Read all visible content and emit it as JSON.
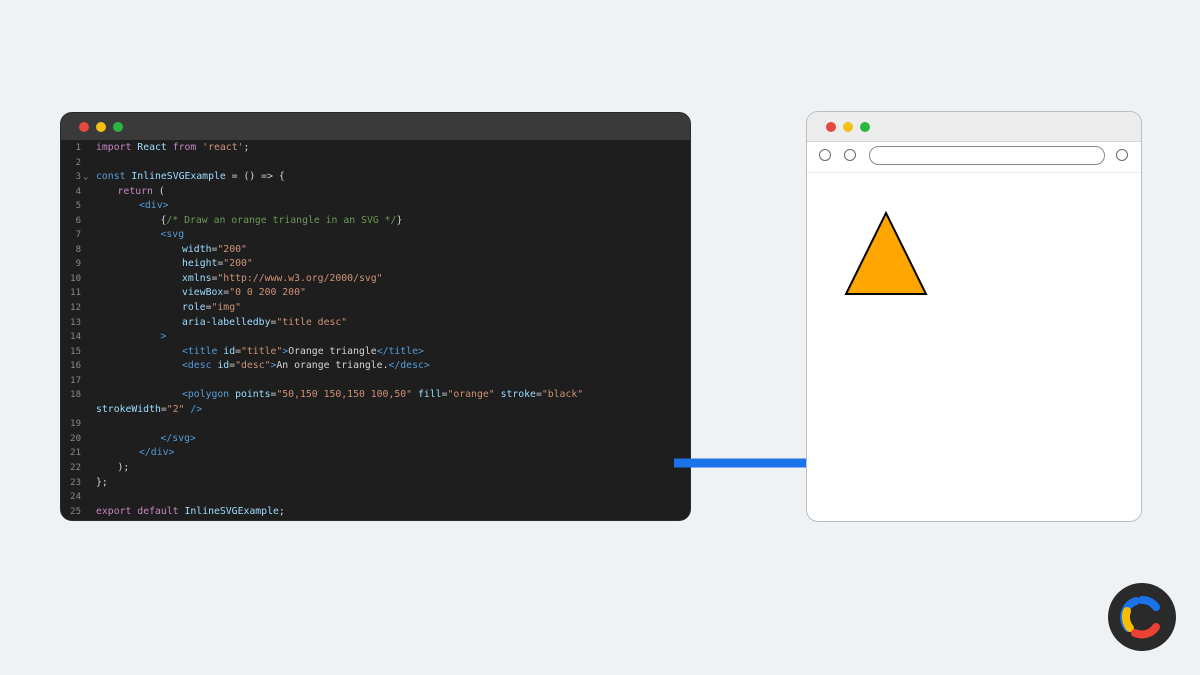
{
  "editor": {
    "lines": [
      {
        "n": "1",
        "fold": "",
        "indent": 0,
        "tokens": [
          [
            "kw",
            "import"
          ],
          [
            "pl",
            " "
          ],
          [
            "fn",
            "React"
          ],
          [
            "pl",
            " "
          ],
          [
            "kw",
            "from"
          ],
          [
            "pl",
            " "
          ],
          [
            "str",
            "'react'"
          ],
          [
            "pl",
            ";"
          ]
        ]
      },
      {
        "n": "2",
        "fold": "",
        "indent": 0,
        "tokens": []
      },
      {
        "n": "3",
        "fold": "⌄",
        "indent": 0,
        "tokens": [
          [
            "kw2",
            "const"
          ],
          [
            "pl",
            " "
          ],
          [
            "fn",
            "InlineSVGExample"
          ],
          [
            "pl",
            " = () => {"
          ]
        ]
      },
      {
        "n": "4",
        "fold": "",
        "indent": 1,
        "tokens": [
          [
            "kw",
            "return"
          ],
          [
            "pl",
            " ("
          ]
        ]
      },
      {
        "n": "5",
        "fold": "",
        "indent": 2,
        "tokens": [
          [
            "tag",
            "<div>"
          ]
        ]
      },
      {
        "n": "6",
        "fold": "",
        "indent": 3,
        "tokens": [
          [
            "pl",
            "{"
          ],
          [
            "cmt",
            "/* Draw an orange triangle in an SVG */"
          ],
          [
            "pl",
            "}"
          ]
        ]
      },
      {
        "n": "7",
        "fold": "",
        "indent": 3,
        "tokens": [
          [
            "tag",
            "<svg"
          ]
        ]
      },
      {
        "n": "8",
        "fold": "",
        "indent": 4,
        "tokens": [
          [
            "attr",
            "width"
          ],
          [
            "pl",
            "="
          ],
          [
            "str",
            "\"200\""
          ]
        ]
      },
      {
        "n": "9",
        "fold": "",
        "indent": 4,
        "tokens": [
          [
            "attr",
            "height"
          ],
          [
            "pl",
            "="
          ],
          [
            "str",
            "\"200\""
          ]
        ]
      },
      {
        "n": "10",
        "fold": "",
        "indent": 4,
        "tokens": [
          [
            "attr",
            "xmlns"
          ],
          [
            "pl",
            "="
          ],
          [
            "str",
            "\"http://www.w3.org/2000/svg\""
          ]
        ]
      },
      {
        "n": "11",
        "fold": "",
        "indent": 4,
        "tokens": [
          [
            "attr",
            "viewBox"
          ],
          [
            "pl",
            "="
          ],
          [
            "str",
            "\"0 0 200 200\""
          ]
        ]
      },
      {
        "n": "12",
        "fold": "",
        "indent": 4,
        "tokens": [
          [
            "attr",
            "role"
          ],
          [
            "pl",
            "="
          ],
          [
            "str",
            "\"img\""
          ]
        ]
      },
      {
        "n": "13",
        "fold": "",
        "indent": 4,
        "tokens": [
          [
            "attr",
            "aria-labelledby"
          ],
          [
            "pl",
            "="
          ],
          [
            "str",
            "\"title desc\""
          ]
        ]
      },
      {
        "n": "14",
        "fold": "",
        "indent": 3,
        "tokens": [
          [
            "tag",
            ">"
          ]
        ]
      },
      {
        "n": "15",
        "fold": "",
        "indent": 4,
        "tokens": [
          [
            "tag",
            "<title"
          ],
          [
            "pl",
            " "
          ],
          [
            "attr",
            "id"
          ],
          [
            "pl",
            "="
          ],
          [
            "str",
            "\"title\""
          ],
          [
            "tag",
            ">"
          ],
          [
            "pl",
            "Orange triangle"
          ],
          [
            "tag",
            "</title>"
          ]
        ]
      },
      {
        "n": "16",
        "fold": "",
        "indent": 4,
        "tokens": [
          [
            "tag",
            "<desc"
          ],
          [
            "pl",
            " "
          ],
          [
            "attr",
            "id"
          ],
          [
            "pl",
            "="
          ],
          [
            "str",
            "\"desc\""
          ],
          [
            "tag",
            ">"
          ],
          [
            "pl",
            "An orange triangle."
          ],
          [
            "tag",
            "</desc>"
          ]
        ]
      },
      {
        "n": "17",
        "fold": "",
        "indent": 0,
        "tokens": []
      },
      {
        "n": "18",
        "fold": "",
        "indent": 4,
        "tokens": [
          [
            "tag",
            "<polygon"
          ],
          [
            "pl",
            " "
          ],
          [
            "attr",
            "points"
          ],
          [
            "pl",
            "="
          ],
          [
            "str",
            "\"50,150 150,150 100,50\""
          ],
          [
            "pl",
            " "
          ],
          [
            "attr",
            "fill"
          ],
          [
            "pl",
            "="
          ],
          [
            "str",
            "\"orange\""
          ],
          [
            "pl",
            " "
          ],
          [
            "attr",
            "stroke"
          ],
          [
            "pl",
            "="
          ],
          [
            "str",
            "\"black\""
          ]
        ]
      },
      {
        "n": "",
        "fold": "",
        "indent": 0,
        "tokens": [
          [
            "attr",
            "strokeWidth"
          ],
          [
            "pl",
            "="
          ],
          [
            "str",
            "\"2\""
          ],
          [
            "pl",
            " "
          ],
          [
            "tag",
            "/>"
          ]
        ]
      },
      {
        "n": "19",
        "fold": "",
        "indent": 0,
        "tokens": []
      },
      {
        "n": "20",
        "fold": "",
        "indent": 3,
        "tokens": [
          [
            "tag",
            "</svg>"
          ]
        ]
      },
      {
        "n": "21",
        "fold": "",
        "indent": 2,
        "tokens": [
          [
            "tag",
            "</div>"
          ]
        ]
      },
      {
        "n": "22",
        "fold": "",
        "indent": 1,
        "tokens": [
          [
            "pl",
            ");"
          ]
        ]
      },
      {
        "n": "23",
        "fold": "",
        "indent": 0,
        "tokens": [
          [
            "pl",
            "};"
          ]
        ]
      },
      {
        "n": "24",
        "fold": "",
        "indent": 0,
        "tokens": []
      },
      {
        "n": "25",
        "fold": "",
        "indent": 0,
        "tokens": [
          [
            "kw",
            "export"
          ],
          [
            "pl",
            " "
          ],
          [
            "kw",
            "default"
          ],
          [
            "pl",
            " "
          ],
          [
            "fn",
            "InlineSVGExample"
          ],
          [
            "pl",
            ";"
          ]
        ]
      }
    ]
  },
  "browser": {
    "url": "",
    "triangle": {
      "fill": "#ffa500",
      "stroke": "#000000"
    }
  },
  "colors": {
    "arrow": "#1a73e8",
    "logo_blue": "#1a73e8",
    "logo_yellow": "#fbbc04",
    "logo_red": "#ea4335",
    "logo_bg": "#2a2a2a"
  },
  "icons": {
    "arrow": "right-arrow-icon",
    "logo": "brand-c-logo-icon"
  }
}
